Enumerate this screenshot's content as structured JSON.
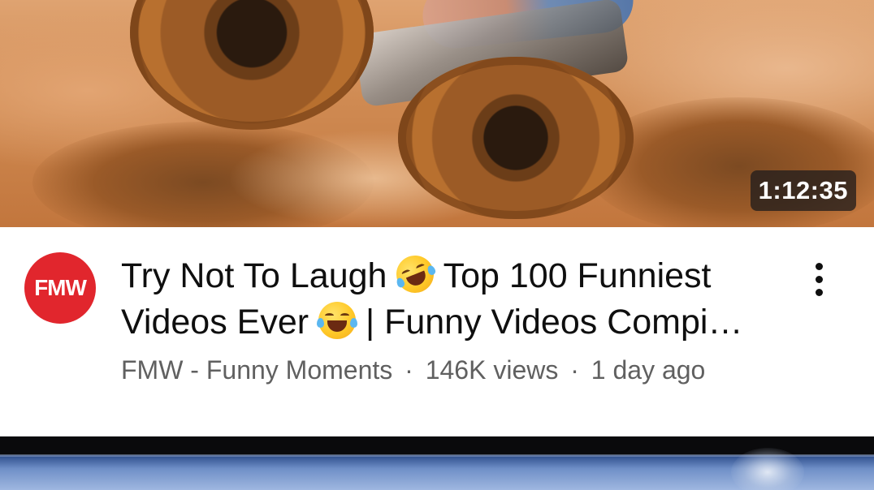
{
  "video": {
    "duration": "1:12:35",
    "title_line1_part1": "Try Not To Laugh",
    "title_line1_part2": "Top 100 Funniest",
    "title_line2_part1": "Videos Ever",
    "title_line2_part2": "| Funny Videos Compi…",
    "channel": "FMW - Funny Moments",
    "separator": "·",
    "views": "146K views",
    "age": "1 day ago",
    "avatar_text": "FMW",
    "emojis": [
      "rolling-on-floor-laughing-emoji",
      "tears-of-joy-emoji"
    ]
  },
  "colors": {
    "avatar_bg": "#e1262d",
    "title_text": "#0f0f0f",
    "meta_text": "#606060",
    "duration_bg": "#231e1c"
  }
}
